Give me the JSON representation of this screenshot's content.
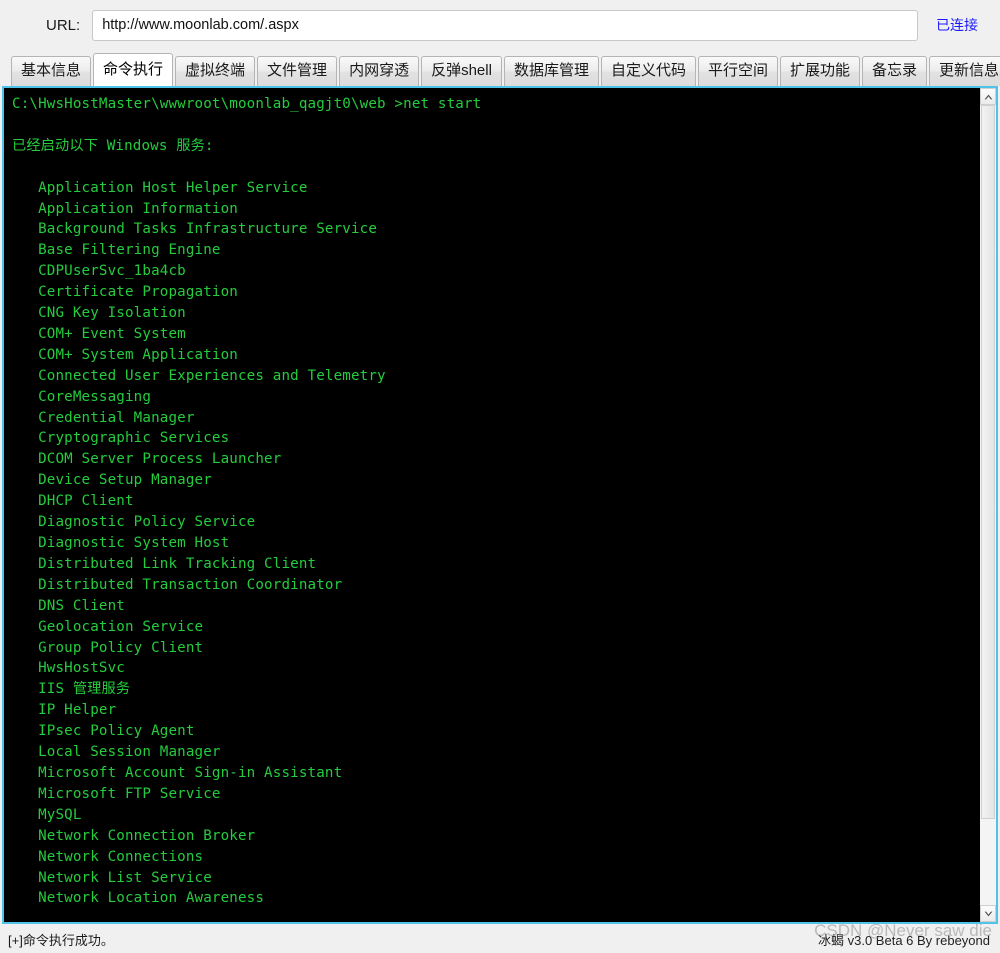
{
  "window": {
    "title": "冰蝎 v3.0 Beta 6"
  },
  "urlbar": {
    "label": "URL:",
    "value": "http://www.moonlab.com/.aspx",
    "placeholder": "http://",
    "connection_status": "已连接"
  },
  "tabs": [
    {
      "label": "基本信息",
      "active": false
    },
    {
      "label": "命令执行",
      "active": true
    },
    {
      "label": "虚拟终端",
      "active": false
    },
    {
      "label": "文件管理",
      "active": false
    },
    {
      "label": "内网穿透",
      "active": false
    },
    {
      "label": "反弹shell",
      "active": false
    },
    {
      "label": "数据库管理",
      "active": false
    },
    {
      "label": "自定义代码",
      "active": false
    },
    {
      "label": "平行空间",
      "active": false
    },
    {
      "label": "扩展功能",
      "active": false
    },
    {
      "label": "备忘录",
      "active": false
    },
    {
      "label": "更新信息",
      "active": false
    }
  ],
  "terminal": {
    "foreground_color": "#25cc3d",
    "background_color": "#000000",
    "border_color": "#4fc3e8",
    "prompt_line": "C:\\HwsHostMaster\\wwwroot\\moonlab_qagjt0\\web >net start",
    "heading": "已经启动以下 Windows 服务:",
    "lines": [
      "C:\\HwsHostMaster\\wwwroot\\moonlab_qagjt0\\web >net start",
      "",
      "已经启动以下 Windows 服务:",
      "",
      "   Application Host Helper Service",
      "   Application Information",
      "   Background Tasks Infrastructure Service",
      "   Base Filtering Engine",
      "   CDPUserSvc_1ba4cb",
      "   Certificate Propagation",
      "   CNG Key Isolation",
      "   COM+ Event System",
      "   COM+ System Application",
      "   Connected User Experiences and Telemetry",
      "   CoreMessaging",
      "   Credential Manager",
      "   Cryptographic Services",
      "   DCOM Server Process Launcher",
      "   Device Setup Manager",
      "   DHCP Client",
      "   Diagnostic Policy Service",
      "   Diagnostic System Host",
      "   Distributed Link Tracking Client",
      "   Distributed Transaction Coordinator",
      "   DNS Client",
      "   Geolocation Service",
      "   Group Policy Client",
      "   HwsHostSvc",
      "   IIS 管理服务",
      "   IP Helper",
      "   IPsec Policy Agent",
      "   Local Session Manager",
      "   Microsoft Account Sign-in Assistant",
      "   Microsoft FTP Service",
      "   MySQL",
      "   Network Connection Broker",
      "   Network Connections",
      "   Network List Service",
      "   Network Location Awareness"
    ],
    "scrollbar": {
      "up_arrow": "scroll-up-icon",
      "down_arrow": "scroll-down-icon",
      "position": "top"
    }
  },
  "statusbar": {
    "message": "[+]命令执行成功。",
    "version": "冰蝎 v3.0 Beta 6   By rebeyond"
  },
  "watermark": {
    "text": "CSDN @Never saw die"
  }
}
